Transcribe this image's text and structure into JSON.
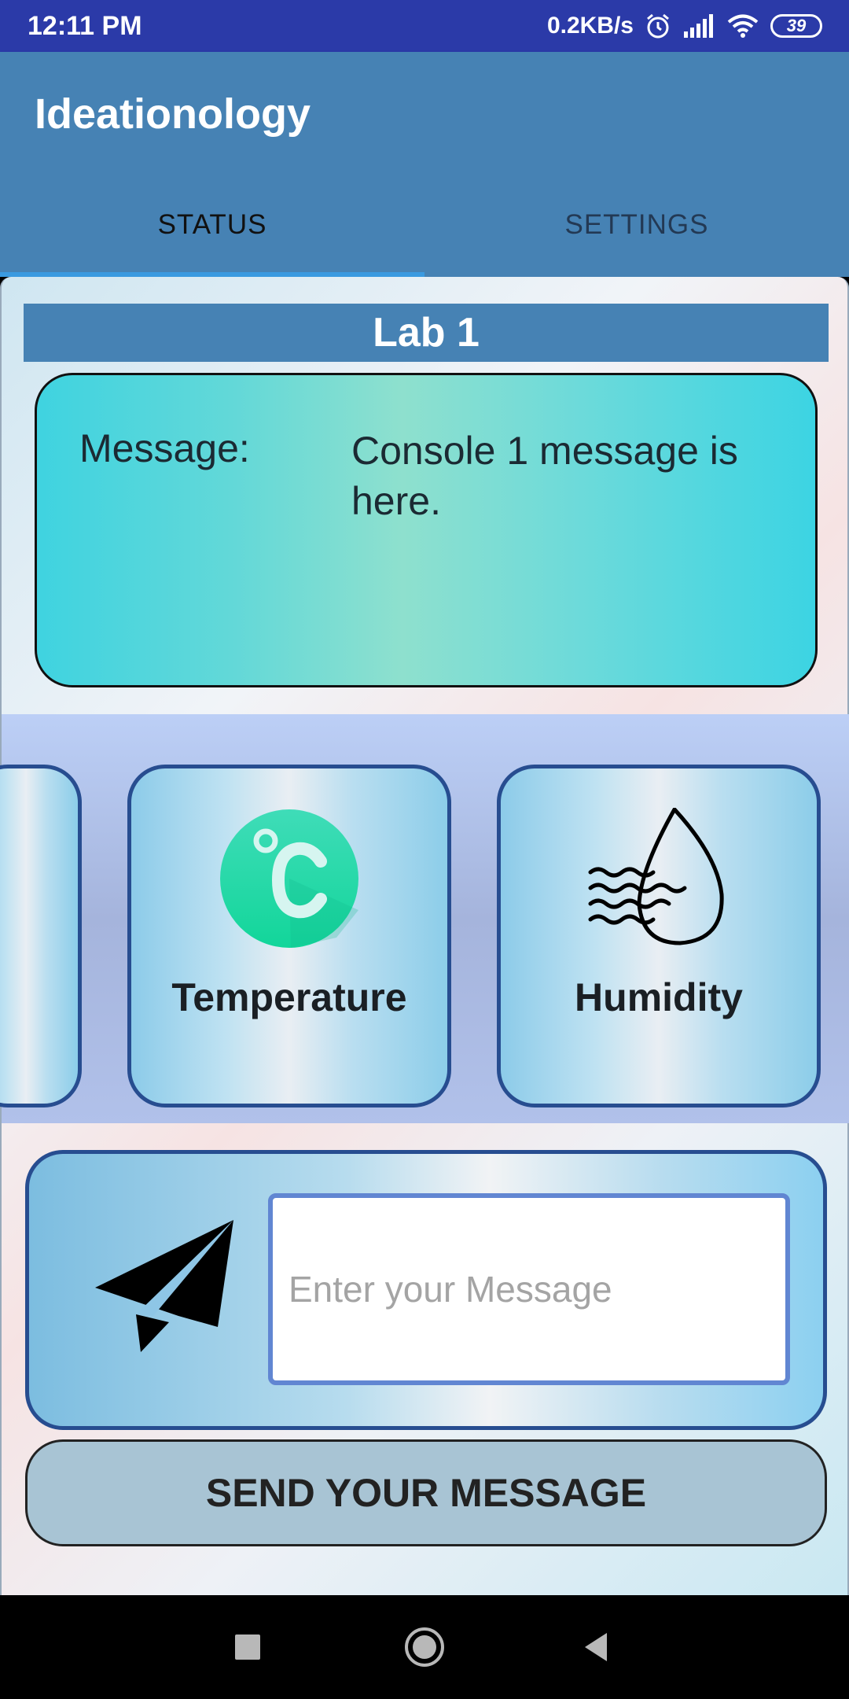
{
  "status_bar": {
    "time": "12:11 PM",
    "network_speed": "0.2KB/s",
    "battery": "39",
    "icons": [
      "alarm-icon",
      "signal-icon",
      "wifi-icon",
      "battery-icon"
    ]
  },
  "app": {
    "title": "Ideationology"
  },
  "tabs": [
    {
      "label": "STATUS",
      "selected": true
    },
    {
      "label": "SETTINGS",
      "selected": false
    }
  ],
  "lab": {
    "title": "Lab 1",
    "message_label": "Message:",
    "message_text": "Console 1 message is here."
  },
  "sensors": [
    {
      "label": "Temperature",
      "icon": "celsius-icon"
    },
    {
      "label": "Humidity",
      "icon": "humidity-drop-icon"
    }
  ],
  "compose": {
    "placeholder": "Enter your Message",
    "value": "",
    "icon": "paper-plane-icon"
  },
  "send_button": {
    "label": "SEND YOUR MESSAGE"
  },
  "nav": {
    "icons": [
      "recents-square-icon",
      "home-circle-icon",
      "back-triangle-icon"
    ]
  },
  "colors": {
    "status_bar": "#2b3aa8",
    "app_bar": "#4682b4",
    "tab_indicator": "#3a9ae0",
    "card_border": "#274d90",
    "message_card": "#8ee0ce",
    "send_button": "#a8c4d4"
  }
}
